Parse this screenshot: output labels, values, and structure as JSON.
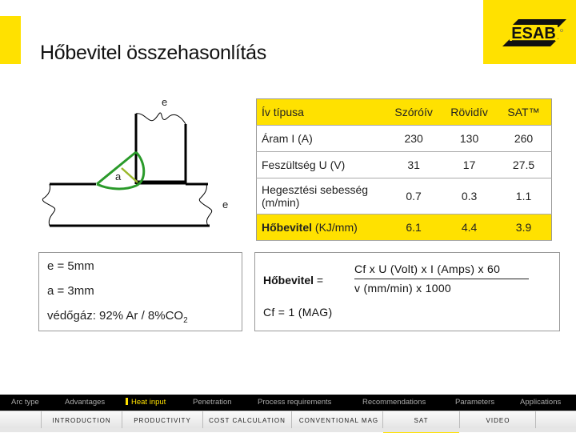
{
  "header": {
    "title": "Hőbevitel összehasonlítás",
    "logo_text": "ESAB",
    "brand_color": "#ffe100"
  },
  "diagram": {
    "label_e_top": "e",
    "label_e_side": "e",
    "label_a": "a",
    "weld_color": "#2a9a2a",
    "throat_color": "#9ab82a"
  },
  "table": {
    "header": [
      "Ív típusa",
      "Szóróív",
      "Rövidív",
      "SAT™"
    ],
    "rows": [
      {
        "label": "Áram I (A)",
        "values": [
          "230",
          "130",
          "260"
        ]
      },
      {
        "label": "Feszültség U (V)",
        "values": [
          "31",
          "17",
          "27.5"
        ]
      },
      {
        "label": "Hegesztési sebesség (m/min)",
        "values": [
          "0.7",
          "0.3",
          "1.1"
        ]
      }
    ],
    "result": {
      "label_bold": "Hőbevitel",
      "label_unit": " (KJ/mm)",
      "values": [
        "6.1",
        "4.4",
        "3.9"
      ]
    }
  },
  "params": {
    "e": "e = 5mm",
    "a": "a = 3mm",
    "gas_prefix": "védőgáz: 92% Ar / 8%CO",
    "gas_sub": "2"
  },
  "formula": {
    "lhs_bold": "Hőbevitel",
    "lhs_eq": " =",
    "numerator": "Cf x U (Volt) x I (Amps) x 60",
    "denominator": "v (mm/min) x 1000",
    "cf": "Cf = 1 (MAG)"
  },
  "nav_main": [
    {
      "label": "Arc type",
      "active": false
    },
    {
      "label": "Advantages",
      "active": false
    },
    {
      "label": "Heat input",
      "active": true
    },
    {
      "label": "Penetration",
      "active": false
    },
    {
      "label": "Process requirements",
      "active": false
    },
    {
      "label": "Recommendations",
      "active": false
    },
    {
      "label": "Parameters",
      "active": false
    },
    {
      "label": "Applications",
      "active": false
    }
  ],
  "nav_sub": [
    {
      "label": "",
      "active": false
    },
    {
      "label": "INTRODUCTION",
      "active": false
    },
    {
      "label": "PRODUCTIVITY",
      "active": false
    },
    {
      "label": "COST CALCULATION",
      "active": false
    },
    {
      "label": "CONVENTIONAL MAG",
      "active": false
    },
    {
      "label": "SAT",
      "active": true
    },
    {
      "label": "VIDEO",
      "active": false
    },
    {
      "label": "",
      "active": false
    }
  ]
}
